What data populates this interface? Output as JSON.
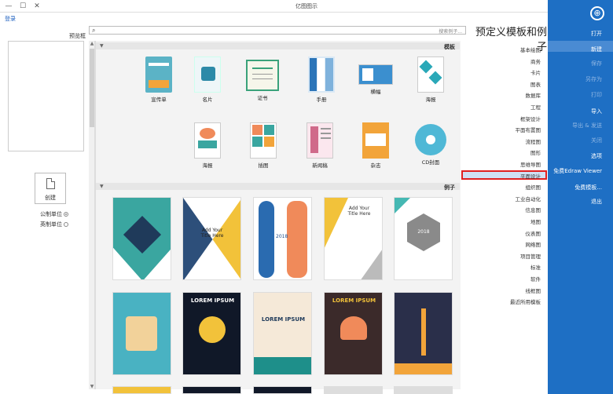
{
  "window": {
    "title": "亿图图示",
    "min": "—",
    "max": "☐",
    "close": "✕"
  },
  "login": "登录",
  "preview": {
    "label": "预览框",
    "create_label": "创建"
  },
  "units": [
    {
      "label": "公制单位",
      "selected": true
    },
    {
      "label": "英制单位",
      "selected": false
    }
  ],
  "search": {
    "placeholder": "搜索例子..."
  },
  "sections": {
    "templates": "模板",
    "examples": "例子"
  },
  "templates": [
    {
      "label": "海报",
      "color": "#3aa6a0"
    },
    {
      "label": "宣传单",
      "color": "#5bb3c6"
    },
    {
      "label": "名片",
      "color": "#2d8aa8"
    },
    {
      "label": "证书",
      "color": "#3aa27a"
    },
    {
      "label": "手册",
      "color": "#2b74b8"
    },
    {
      "label": "横幅",
      "color": "#3b8fcf"
    },
    {
      "label": "海报",
      "color": "#2aa8b8"
    },
    {
      "label": "CD封面",
      "color": "#4fb8d6"
    },
    {
      "label": "杂志",
      "color": "#f2a43a"
    },
    {
      "label": "新闻稿",
      "color": "#d06a8a"
    },
    {
      "label": "插图",
      "color": "#f08a5a"
    },
    {
      "label": "海报",
      "color": "#e8a25a"
    }
  ],
  "examples_row1": [
    {
      "text": "",
      "color": "#3aa6a0"
    },
    {
      "text": "Add Your Title Here",
      "color": "#f2c23a"
    },
    {
      "text": "2018",
      "color": "#1e4d8c"
    },
    {
      "text": "Add Your Title Here",
      "color": "#f2c23a"
    },
    {
      "text": "2018",
      "color": "#45b8b3"
    }
  ],
  "examples_row2": [
    {
      "text": "",
      "color": "#2a2f4a"
    },
    {
      "text": "LOREM IPSUM",
      "color": "#3b2a2a"
    },
    {
      "text": "LOREM IPSUM",
      "color": "#f5e9d8"
    },
    {
      "text": "LOREM IPSUM",
      "color": "#101828"
    },
    {
      "text": "",
      "color": "#49b2c2"
    }
  ],
  "category_title": "预定义模板和例子",
  "categories": [
    "基本绘图",
    "商务",
    "卡片",
    "图表",
    "数据库",
    "工程",
    "框架设计",
    "平面布置图",
    "流程图",
    "图形",
    "思维导图",
    "平面设计",
    "组织图",
    "工业自动化",
    "信息图",
    "地图",
    "仪表图",
    "网络图",
    "项目管理",
    "标准",
    "软件",
    "线框图",
    "最近所用模板"
  ],
  "category_selected": "平面设计",
  "nav": {
    "logo": "⊕",
    "items": [
      {
        "label": "打开",
        "dim": false
      },
      {
        "label": "新建",
        "dim": false
      },
      {
        "label": "保存",
        "dim": true
      },
      {
        "label": "另存为",
        "dim": true
      },
      {
        "label": "打印",
        "dim": true
      },
      {
        "label": "导入",
        "dim": false
      },
      {
        "label": "导出 & 发送",
        "dim": true
      },
      {
        "label": "关闭",
        "dim": true
      },
      {
        "label": "选项",
        "dim": false
      },
      {
        "label": "免费Edraw Viewer",
        "dim": false
      },
      {
        "label": "免费模板...",
        "dim": false
      },
      {
        "label": "退出",
        "dim": false
      }
    ]
  }
}
